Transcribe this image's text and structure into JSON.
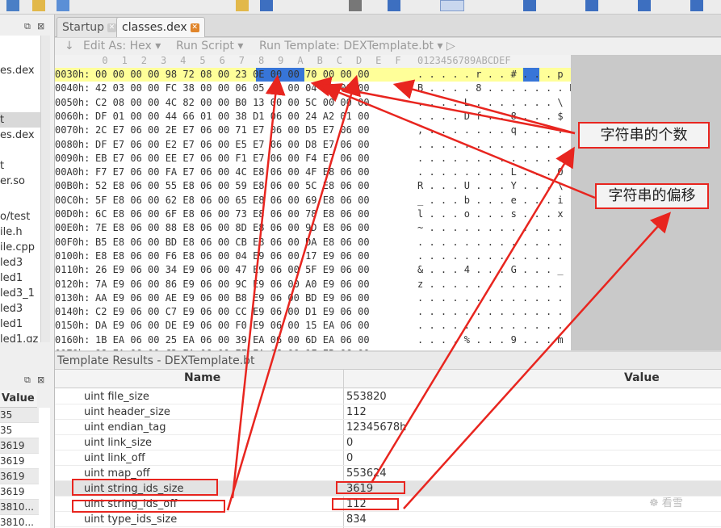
{
  "tabs": [
    {
      "label": "Startup",
      "active": false
    },
    {
      "label": "classes.dex",
      "active": true
    }
  ],
  "edit_toolbar": {
    "edit_as": "Edit As: Hex ▾",
    "run_script": "Run Script ▾",
    "run_template": "Run Template: DEXTemplate.bt ▾"
  },
  "left_panel": {
    "items": [
      {
        "label": "es.dex",
        "selected": false
      },
      {
        "label": "t",
        "selected": true
      },
      {
        "label": "es.dex",
        "selected": false
      },
      {
        "label": "t",
        "selected": false
      },
      {
        "label": "er.so",
        "selected": false
      },
      {
        "label": "o/test",
        "selected": false
      },
      {
        "label": "ile.h",
        "selected": false
      },
      {
        "label": "ile.cpp",
        "selected": false
      },
      {
        "label": "led3",
        "selected": false
      },
      {
        "label": "led1",
        "selected": false
      },
      {
        "label": "led3_1",
        "selected": false
      },
      {
        "label": "led3",
        "selected": false
      },
      {
        "label": "led1",
        "selected": false
      },
      {
        "label": "led1.gz",
        "selected": false
      },
      {
        "label": "led1",
        "selected": false
      }
    ],
    "value_header": "Value",
    "values": [
      "35",
      "35",
      "3619",
      "3619",
      "3619",
      "3619",
      "3810...",
      "3810..."
    ]
  },
  "hex": {
    "columns": [
      "0",
      "1",
      "2",
      "3",
      "4",
      "5",
      "6",
      "7",
      "8",
      "9",
      "A",
      "B",
      "C",
      "D",
      "E",
      "F"
    ],
    "ascii_header": "0123456789ABCDEF",
    "rows": [
      {
        "offset": "0030h:",
        "bytes": "00 00 00 00 98 72 08 00 23 0E 00 00 70 00 00 00",
        "ascii": ". . . . . r . . # . . . p . . ."
      },
      {
        "offset": "0040h:",
        "bytes": "42 03 00 00 FC 38 00 00 06 05 00 00 04 16 00 00",
        "ascii": "B . . . . 8 . . . . . . . F . ."
      },
      {
        "offset": "0050h:",
        "bytes": "C2 08 00 00 4C 82 00 00 B0 13 00 00 5C 00 00 00",
        "ascii": ". . . . L . . . . . . . \\ . . ."
      },
      {
        "offset": "0060h:",
        "bytes": "DF 01 00 00 44 66 01 00 38 D1 06 00 24 A2 01 00",
        "ascii": ". . . . D f . . 8 . . . $ . . ."
      },
      {
        "offset": "0070h:",
        "bytes": "2C E7 06 00 2E E7 06 00 71 E7 06 00 D5 E7 06 00",
        "ascii": ", . . . . . . . q . . . . . . ."
      },
      {
        "offset": "0080h:",
        "bytes": "DF E7 06 00 E2 E7 06 00 E5 E7 06 00 D8 E7 06 00",
        "ascii": ". . . . . . . . . . . . . . . ."
      },
      {
        "offset": "0090h:",
        "bytes": "EB E7 06 00 EE E7 06 00 F1 E7 06 00 F4 E7 06 00",
        "ascii": ". . . . . . . . . . . . . . . ."
      },
      {
        "offset": "00A0h:",
        "bytes": "F7 E7 06 00 FA E7 06 00 4C E8 06 00 4F E8 06 00",
        "ascii": ". . . . . . . . L . . . O . . ."
      },
      {
        "offset": "00B0h:",
        "bytes": "52 E8 06 00 55 E8 06 00 59 E8 06 00 5C E8 06 00",
        "ascii": "R . . . U . . . Y . . . \\ . . ."
      },
      {
        "offset": "00C0h:",
        "bytes": "5F E8 06 00 62 E8 06 00 65 E8 06 00 69 E8 06 00",
        "ascii": "_ . . . b . . . e . . . i . . ."
      },
      {
        "offset": "00D0h:",
        "bytes": "6C E8 06 00 6F E8 06 00 73 E8 06 00 78 E8 06 00",
        "ascii": "l . . . o . . . s . . . x . . ."
      },
      {
        "offset": "00E0h:",
        "bytes": "7E E8 06 00 88 E8 06 00 8D E8 06 00 9D E8 06 00",
        "ascii": "~ . . . . . . . . . . . . . . ."
      },
      {
        "offset": "00F0h:",
        "bytes": "B5 E8 06 00 BD E8 06 00 CB E8 06 00 DA E8 06 00",
        "ascii": ". . . . . . . . . . . . . . . ."
      },
      {
        "offset": "0100h:",
        "bytes": "E8 E8 06 00 F6 E8 06 00 04 E9 06 00 17 E9 06 00",
        "ascii": ". . . . . . . . . . . . . . . ."
      },
      {
        "offset": "0110h:",
        "bytes": "26 E9 06 00 34 E9 06 00 47 E9 06 00 5F E9 06 00",
        "ascii": "& . . . 4 . . . G . . . _ . . ."
      },
      {
        "offset": "0120h:",
        "bytes": "7A E9 06 00 86 E9 06 00 9C E9 06 00 A0 E9 06 00",
        "ascii": "z . . . . . . . . . . . . . . ."
      },
      {
        "offset": "0130h:",
        "bytes": "AA E9 06 00 AE E9 06 00 B8 E9 06 00 BD E9 06 00",
        "ascii": ". . . . . . . . . . . . . . . ."
      },
      {
        "offset": "0140h:",
        "bytes": "C2 E9 06 00 C7 E9 06 00 CC E9 06 00 D1 E9 06 00",
        "ascii": ". . . . . . . . . . . . . . . ."
      },
      {
        "offset": "0150h:",
        "bytes": "DA E9 06 00 DE E9 06 00 F0 E9 06 00 15 EA 06 00",
        "ascii": ". . . . . . . . . . . . . . . ."
      },
      {
        "offset": "0160h:",
        "bytes": "1B EA 06 00 25 EA 06 00 39 EA 06 00 6D EA 06 00",
        "ascii": ". . . . % . . . 9 . . . m . . ."
      },
      {
        "offset": "0170h:",
        "bytes": "98 EA 06 00 C3 EA 06 00 EF EA 06 00 1F EB 06 00",
        "ascii": ". . . . . . . . . . . . . . . ."
      },
      {
        "offset": "0180h:",
        "bytes": "4A EB 06 00 74 EB 06 00 9F EB 06 00 C9 EB 06 00",
        "ascii": "J . . . t . . . . . . . . . . ."
      },
      {
        "offset": "0190h:",
        "bytes": "F2 EB 06 00 28 EC 06 00 41 EC 06 00 64 EC 06 00",
        "ascii": ". . . . ( . . . A . . . d . . ."
      }
    ]
  },
  "template_results": {
    "title": "Template Results - DEXTemplate.bt",
    "col_name": "Name",
    "col_value": "Value",
    "rows": [
      {
        "name": "uint file_size",
        "value": "553820",
        "shade": false
      },
      {
        "name": "uint header_size",
        "value": "112",
        "shade": false
      },
      {
        "name": "uint endian_tag",
        "value": "12345678h",
        "shade": false
      },
      {
        "name": "uint link_size",
        "value": "0",
        "shade": false
      },
      {
        "name": "uint link_off",
        "value": "0",
        "shade": false
      },
      {
        "name": "uint map_off",
        "value": "553624",
        "shade": false
      },
      {
        "name": "uint string_ids_size",
        "value": "3619",
        "shade": true
      },
      {
        "name": "uint string_ids_off",
        "value": "112",
        "shade": false
      },
      {
        "name": "uint type_ids_size",
        "value": "834",
        "shade": false
      }
    ]
  },
  "annotations": {
    "count_label": "字符串的个数",
    "offset_label": "字符串的偏移",
    "color": "#e8251f"
  },
  "watermark": "☸ 看雪"
}
